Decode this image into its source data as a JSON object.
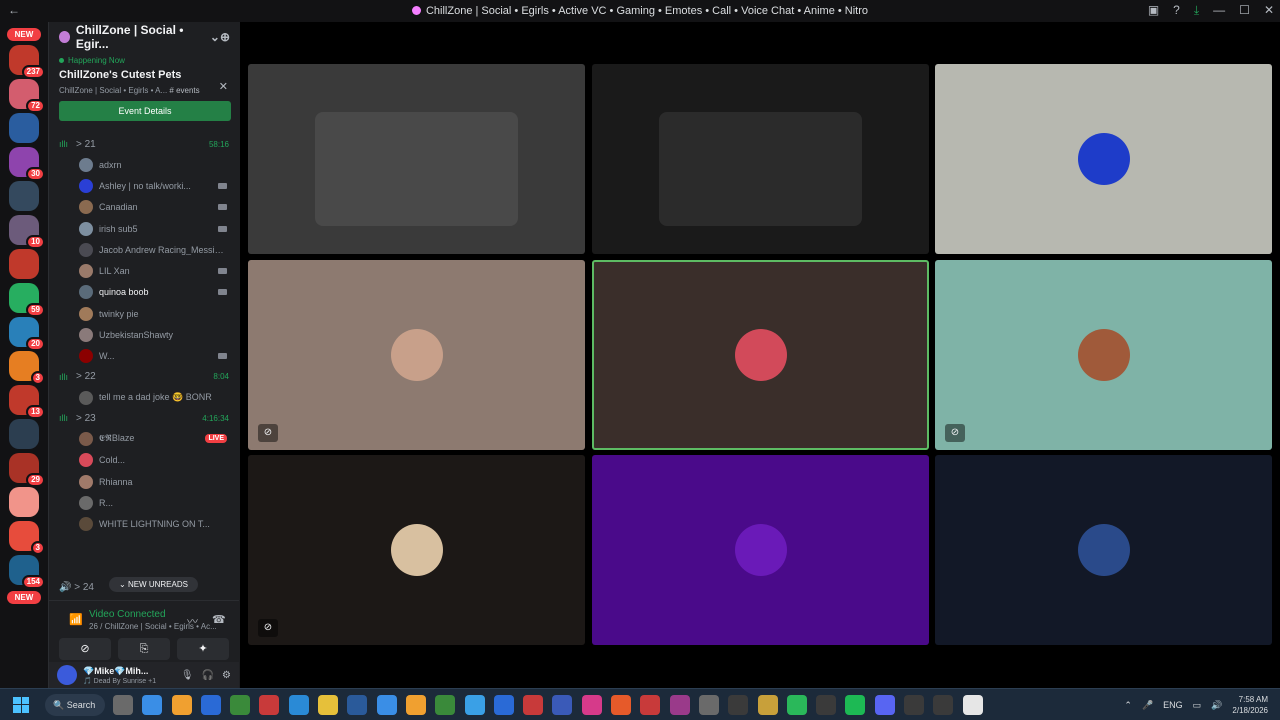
{
  "window": {
    "title": "ChillZone | Social • Egirls • Active VC • Gaming • Emotes • Call • Voice Chat • Anime • Nitro"
  },
  "servers": [
    {
      "name": "new",
      "badge": "NEW",
      "color": "#f23f43"
    },
    {
      "name": "s1",
      "badge": "237",
      "color": "#c0392b"
    },
    {
      "name": "s2",
      "badge": "72",
      "color": "#d35d6e"
    },
    {
      "name": "s3",
      "badge": "",
      "color": "#2a5d9f"
    },
    {
      "name": "s4",
      "badge": "30",
      "color": "#8e44ad"
    },
    {
      "name": "s5",
      "badge": "",
      "color": "#34495e"
    },
    {
      "name": "s6",
      "badge": "10",
      "color": "#6c5b7b"
    },
    {
      "name": "s7",
      "badge": "",
      "color": "#c0392b"
    },
    {
      "name": "s8",
      "badge": "59",
      "color": "#27ae60"
    },
    {
      "name": "s9",
      "badge": "20",
      "color": "#2980b9"
    },
    {
      "name": "s10",
      "badge": "3",
      "color": "#e67e22"
    },
    {
      "name": "s11",
      "badge": "13",
      "color": "#c0392b"
    },
    {
      "name": "s12",
      "badge": "",
      "color": "#2c3e50"
    },
    {
      "name": "s13",
      "badge": "29",
      "color": "#a93226"
    },
    {
      "name": "s14",
      "badge": "",
      "color": "#f1948a"
    },
    {
      "name": "s15",
      "badge": "3",
      "color": "#e74c3c"
    },
    {
      "name": "s16",
      "badge": "154",
      "color": "#1f618d"
    },
    {
      "name": "s17",
      "badge": "NEW",
      "color": "#f23f43"
    }
  ],
  "guild": {
    "name": "ChillZone | Social • Egir...",
    "add_user_icon": "add-user-icon"
  },
  "event": {
    "status": "Happening Now",
    "title": "ChillZone's Cutest Pets",
    "location": "ChillZone | Social • Egirls • A...",
    "channel": "# events",
    "button": "Event Details"
  },
  "voice_channels": [
    {
      "name": "21",
      "timer": "58:16",
      "members": [
        {
          "name": "adxrn",
          "camera": false,
          "bright": false,
          "color": "#6d7c8e"
        },
        {
          "name": "Ashley | no talk/worki...",
          "camera": true,
          "bright": false,
          "color": "#2a3fd6"
        },
        {
          "name": "Canadian",
          "camera": true,
          "bright": false,
          "color": "#8a6a50"
        },
        {
          "name": "irish sub5",
          "camera": true,
          "bright": false,
          "color": "#7d8fa0"
        },
        {
          "name": "Jacob Andrew Racing_Messiah...",
          "camera": false,
          "bright": false,
          "color": "#4a4a52"
        },
        {
          "name": "LIL Xan",
          "camera": true,
          "bright": false,
          "color": "#9a7a6a"
        },
        {
          "name": "quinoa boob",
          "camera": true,
          "bright": true,
          "color": "#5a6b7a"
        },
        {
          "name": "twinky pie",
          "camera": false,
          "bright": false,
          "color": "#a07a5a"
        },
        {
          "name": "UzbekistanShawty",
          "camera": false,
          "bright": false,
          "color": "#8a7a7a"
        },
        {
          "name": "W...",
          "camera": true,
          "bright": false,
          "color": "#8b0000"
        }
      ]
    },
    {
      "name": "22",
      "timer": "8:04",
      "members": [
        {
          "name": "tell me a dad joke 🤓 BONR",
          "camera": false,
          "bright": false,
          "color": "#5a5a5a"
        }
      ]
    },
    {
      "name": "23",
      "timer": "4:16:34",
      "members": [
        {
          "name": "𝕰𝕽Blaze",
          "camera": false,
          "bright": false,
          "live": "LIVE",
          "color": "#7a5a4a"
        },
        {
          "name": "Cold...",
          "camera": false,
          "bright": false,
          "color": "#d84a5a"
        },
        {
          "name": "Rhianna",
          "camera": false,
          "bright": false,
          "color": "#a07a6a"
        },
        {
          "name": "R...",
          "camera": false,
          "bright": false,
          "color": "#6a6a6a"
        },
        {
          "name": "WHITE LIGHTNING ON T...",
          "camera": false,
          "bright": false,
          "color": "#5a4a3a"
        }
      ]
    }
  ],
  "unread": {
    "label": "NEW UNREADS",
    "channel": "24"
  },
  "voice_status": {
    "title": "Video Connected",
    "channel": "26 / ChillZone | Social • Egirls • Ac..."
  },
  "user": {
    "name": "💎Mike💎Mih...",
    "status": "🎵 Dead By Sunrise +1"
  },
  "tiles": [
    {
      "label": "webcam-room",
      "bg": "#3a3a3a",
      "avatar": null,
      "mute": false
    },
    {
      "label": "webcam-hat",
      "bg": "#1a1a1a",
      "avatar": null,
      "mute": false
    },
    {
      "label": "avatar-tile-1",
      "bg": "#b7b8b0",
      "avatar": "#1e3cc9",
      "mute": false
    },
    {
      "label": "avatar-tile-2",
      "bg": "#8d7a70",
      "avatar": "#c8a08a",
      "mute": true
    },
    {
      "label": "avatar-tile-3",
      "bg": "#3a2e2a",
      "avatar": "#d24a5a",
      "mute": false,
      "speaking": true
    },
    {
      "label": "avatar-tile-4",
      "bg": "#7fb3a7",
      "avatar": "#a05a3a",
      "mute": true
    },
    {
      "label": "avatar-tile-5",
      "bg": "#1c1816",
      "avatar": "#d8c0a0",
      "mute": true
    },
    {
      "label": "avatar-tile-6",
      "bg": "#4a0a8a",
      "avatar": "#6a1ab8",
      "mute": false
    },
    {
      "label": "avatar-tile-7",
      "bg": "#121827",
      "avatar": "#2a4a8a",
      "mute": false
    }
  ],
  "taskbar": {
    "search": "Search",
    "lang": "ENG",
    "time": "7:58 AM",
    "date": "2/18/2026"
  }
}
